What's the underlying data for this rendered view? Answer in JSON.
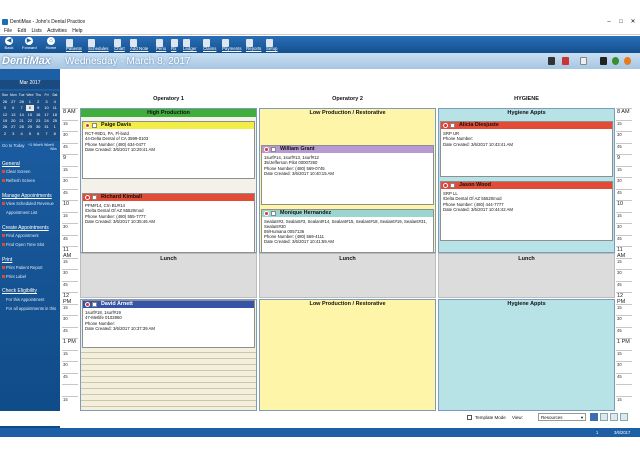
{
  "window": {
    "title": "DentiMax - John's Dental Practice"
  },
  "menu": [
    "File",
    "Edit",
    "Lists",
    "Activities",
    "Help"
  ],
  "toolbar": {
    "back": "Back",
    "forward": "Forward",
    "home": "Home",
    "items": [
      "Patients",
      "Schedules",
      "Chart",
      "Add Note",
      "Perio",
      "Rx",
      "Ledger",
      "Claims",
      "Payments",
      "Reports",
      "Setup"
    ]
  },
  "header": {
    "logo": "DentiMax",
    "date": "Wednesday - March 8, 2017"
  },
  "calendar": {
    "month": "Mar 2017",
    "days": [
      "Sun",
      "Mon",
      "Tue",
      "Wed",
      "Thu",
      "Fri",
      "Sat"
    ],
    "weeks": [
      [
        "26",
        "27",
        "28",
        "1",
        "2",
        "3",
        "4"
      ],
      [
        "5",
        "6",
        "7",
        "8",
        "9",
        "10",
        "11"
      ],
      [
        "12",
        "13",
        "14",
        "15",
        "16",
        "17",
        "18"
      ],
      [
        "19",
        "20",
        "21",
        "22",
        "23",
        "24",
        "25"
      ],
      [
        "26",
        "27",
        "28",
        "29",
        "30",
        "31",
        "1"
      ],
      [
        "2",
        "3",
        "4",
        "5",
        "6",
        "7",
        "8"
      ]
    ],
    "goto_today": "Go to Today",
    "jumps": [
      "+3 Wks",
      "+6 Wks",
      "+6 Wks"
    ]
  },
  "sidebar": {
    "general": {
      "title": "General",
      "items": [
        "Clear Screen",
        "Refresh Screen"
      ]
    },
    "manage": {
      "title": "Manage Appointments",
      "items": [
        "View Scheduled Revenue",
        "Appointment List"
      ]
    },
    "create": {
      "title": "Create Appointments",
      "items": [
        "Find Appointment",
        "Find Open Time Slot"
      ]
    },
    "print": {
      "title": "Print",
      "items": [
        "Print Patient Report",
        "Print Label"
      ]
    },
    "eligibility": {
      "title": "Check Eligibility",
      "items": [
        "For this Appointment",
        "For all appointments in this"
      ]
    },
    "bookmark": "Bookmark this window"
  },
  "columns": [
    {
      "name": "Operatory 1"
    },
    {
      "name": "Operatory 2"
    },
    {
      "name": "HYGIENE"
    }
  ],
  "times": {
    "hours_left": [
      "8 AM",
      "9",
      "10",
      "11 AM",
      "12 PM",
      "1 PM"
    ],
    "minutes": [
      "15",
      "30",
      "45"
    ]
  },
  "blocks": {
    "op1_top": "High Production",
    "op2_top": "Low Production / Restorative",
    "hyg_top": "Hygiene Appts",
    "lunch": "Lunch",
    "op2_bottom": "Low Production / Restorative",
    "hyg_bottom": "Hygiene Appts"
  },
  "appointments": {
    "paige": {
      "name": "Paige Davis",
      "lines": [
        "RCT-#8D1, PA, Fl-butd",
        "44-Delta Dental of CA 3599-0103",
        "Phone Number: (480) 634-0477",
        "Date Created: 3/6/2017 10:29:41 AM"
      ]
    },
    "richard": {
      "name": "Richard Kimball",
      "lines": [
        "PFM#14, Crn BU#14",
        "/Delta Dental Of AZ 55520mod",
        "Phone Number: (480) 555-7777",
        "Date Created: 3/6/2017 10:35:46 AM"
      ]
    },
    "william": {
      "name": "William Grant",
      "lines": [
        "1surf#14, 1surf#13, 1surf#12",
        "35/Jefferson Pilot 00007260",
        "Phone Number: (480) 569-0745",
        "Date Created: 3/6/2017 10:40:15 AM"
      ]
    },
    "monique": {
      "name": "Monique Hernandez",
      "lines": [
        "Sealant#2, Sealant#3, Sealant#14, Sealant#15, Sealant#18, Sealant#19, Sealant#31,",
        "Sealant#30",
        "59/Humana 0057136",
        "Phone Number: (480) 569-4111",
        "Date Created: 3/6/2017 10:41:59 AM"
      ]
    },
    "alicia": {
      "name": "Alicia Diesjuste",
      "lines": [
        "SRP UR",
        "Phone Number:",
        "Date Created: 3/6/2017 10:43:41 AM"
      ]
    },
    "jason": {
      "name": "Jason Wood",
      "lines": [
        "SRP LL",
        "/Delta Dental Of AZ 55520mod",
        "Phone Number: (480) 444-7777",
        "Date Created: 3/6/2017 10:44:42 AM"
      ]
    },
    "david": {
      "name": "David Arnett",
      "lines": [
        "1surf#18, 1surf#19",
        "47-Metlife 0102860",
        "Phone Number:",
        "Date Created: 3/6/2017 10:37:39 AM"
      ]
    }
  },
  "footer": {
    "template_mode": "Template Mode",
    "view_label": "View:",
    "view_value": "Resources"
  },
  "status": {
    "page": "1",
    "date": "3/6/2017"
  },
  "colors": {
    "accent": "#1b5ea5",
    "high_production": "#3fae3a",
    "low_production": "#fff5a8",
    "hygiene": "#b7e2e6",
    "lunch": "#dcdcdc"
  }
}
